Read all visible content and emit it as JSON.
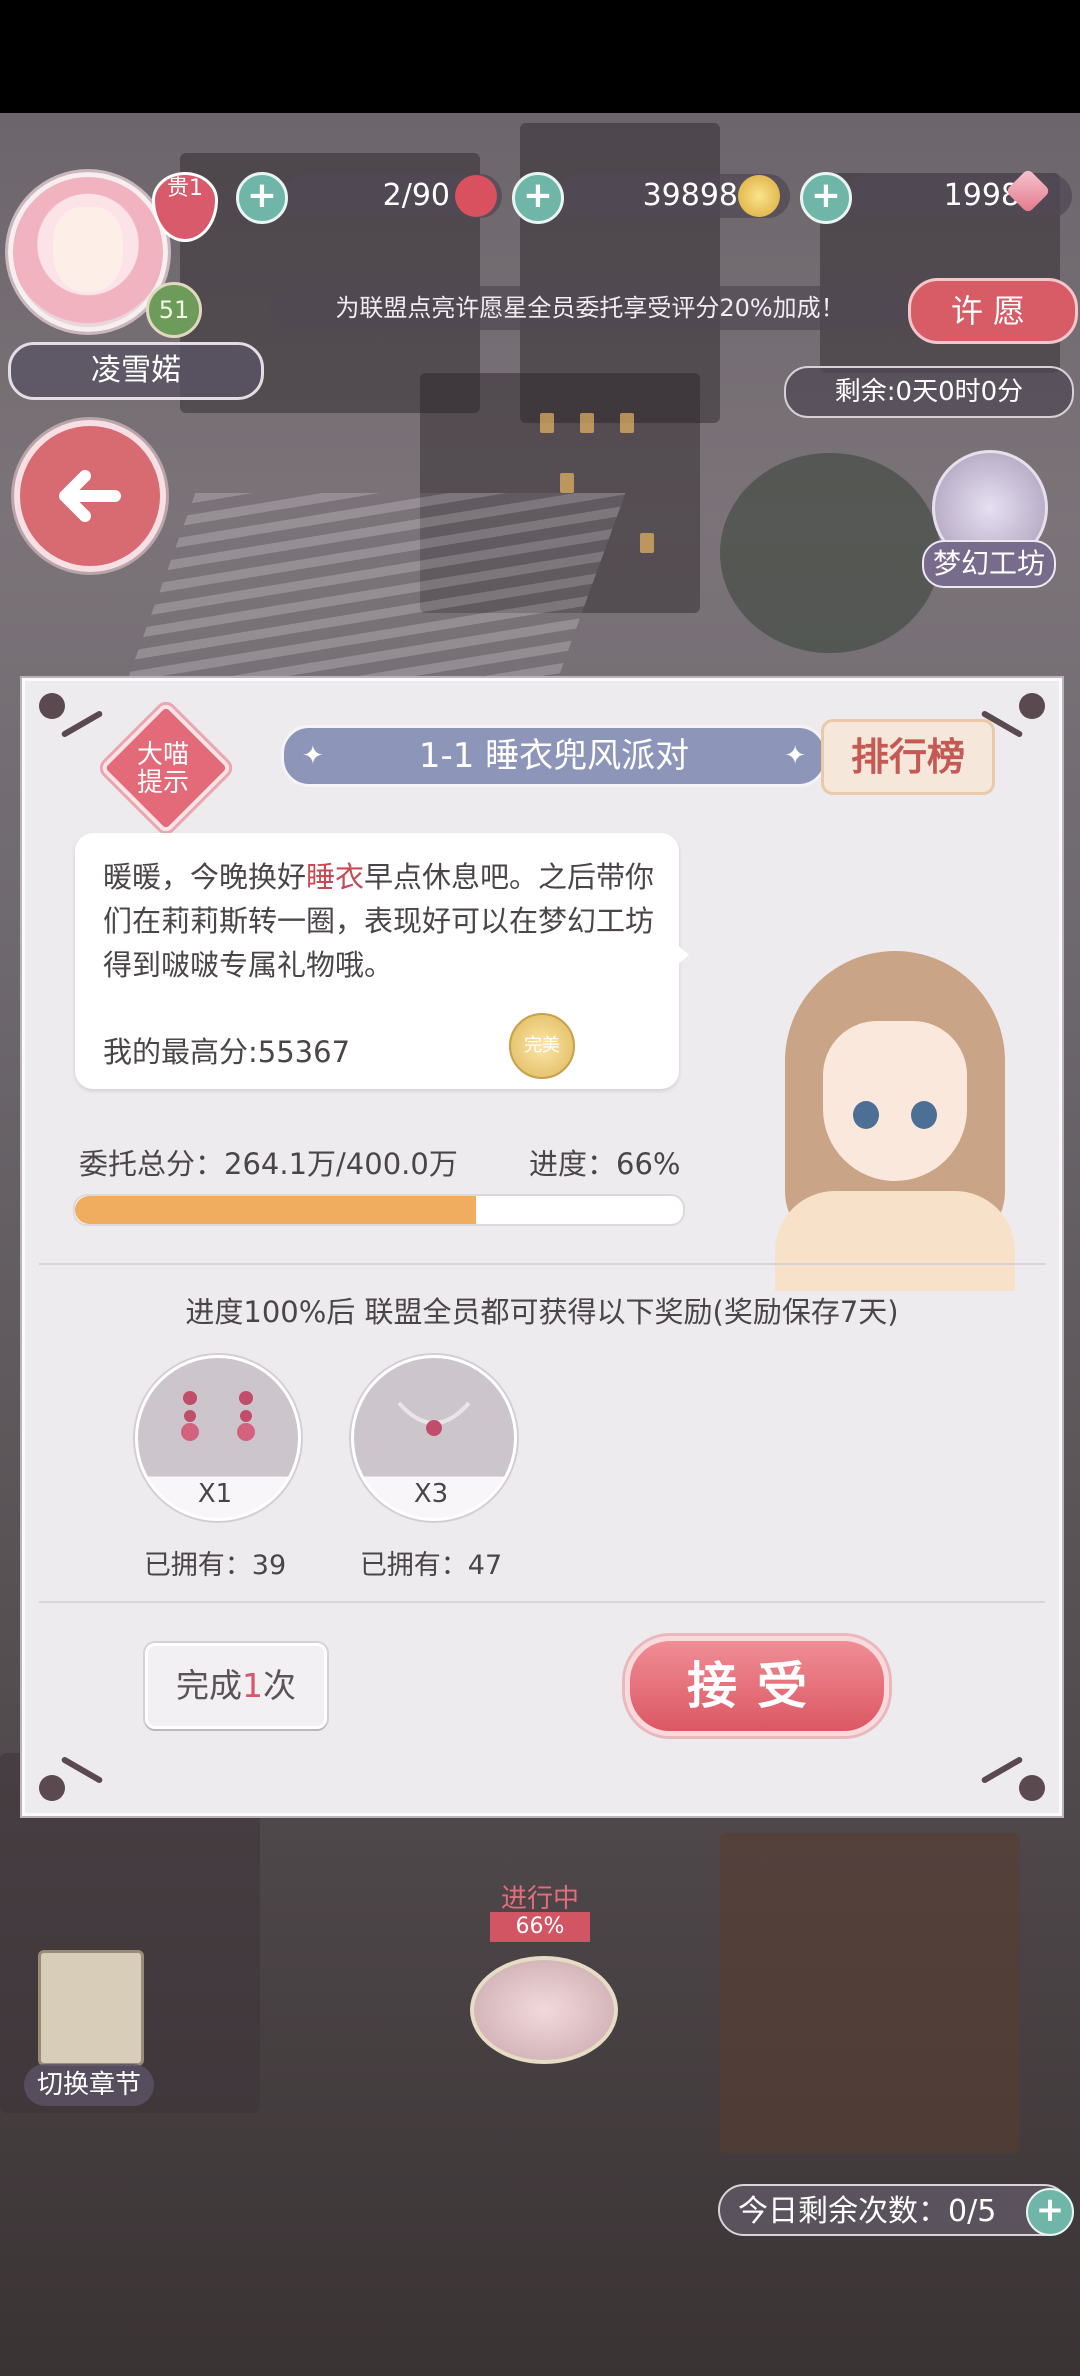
{
  "hud": {
    "vip_label": "贵1",
    "level": "51",
    "player_name": "凌雪婼",
    "stamina": "2/90",
    "gold": "39898",
    "diamonds": "1998",
    "notice": "为联盟点亮许愿星全员委托享受评分20%加成！",
    "wish_label": "许愿",
    "remaining_time": "剩余:0天0时0分",
    "workshop_label": "梦幻工坊",
    "colors": {
      "accent": "#d85c66",
      "plus": "#6fb6a9"
    }
  },
  "panel": {
    "hint_label": "大喵提示",
    "title": "1-1 睡衣兜风派对",
    "rank_label": "排行榜",
    "message_pre": "暖暖，今晚换好",
    "message_highlight": "睡衣",
    "message_post": "早点休息吧。之后带你们在莉莉斯转一圈，表现好可以在梦幻工坊得到啵啵专属礼物哦。",
    "best_score": "我的最高分:55367",
    "medal_label": "完美",
    "total_score": "委托总分：264.1万/400.0万",
    "progress_text": "进度：66%",
    "progress_value": 0.66,
    "reward_desc": "进度100%后 联盟全员都可获得以下奖励(奖励保存7天)",
    "rewards": [
      {
        "icon": "earrings-icon",
        "qty": "X1",
        "owned": "已拥有：39"
      },
      {
        "icon": "necklace-icon",
        "qty": "X3",
        "owned": "已拥有：47"
      }
    ],
    "complete_pre": "完成",
    "complete_count": "1",
    "complete_post": "次",
    "accept_label": "接受"
  },
  "bottom": {
    "chapter_label": "切换章节",
    "in_progress": "进行中",
    "in_progress_pct": "66%",
    "daily_remaining": "今日剩余次数：0/5"
  }
}
